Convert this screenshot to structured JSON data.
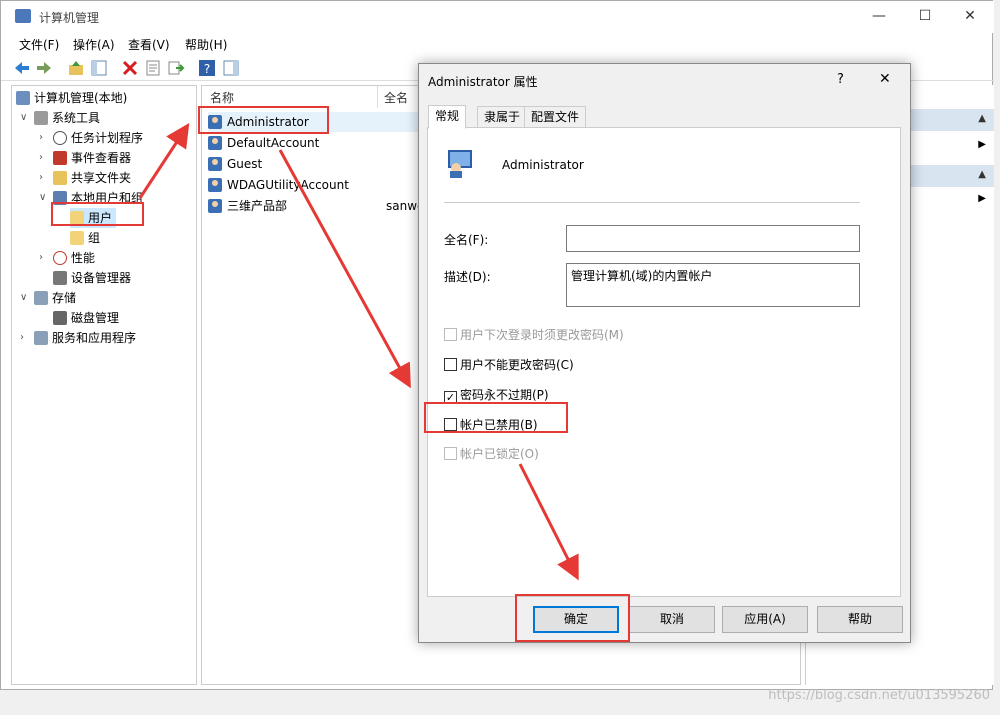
{
  "window": {
    "title": "计算机管理",
    "controls": [
      "—",
      "☐",
      "✕"
    ]
  },
  "menu": [
    "文件(F)",
    "操作(A)",
    "查看(V)",
    "帮助(H)"
  ],
  "tree": [
    {
      "label": "计算机管理(本地)",
      "depth": 0,
      "expander": ""
    },
    {
      "label": "系统工具",
      "depth": 1,
      "expander": "∨"
    },
    {
      "label": "任务计划程序",
      "depth": 2,
      "expander": "›"
    },
    {
      "label": "事件查看器",
      "depth": 2,
      "expander": "›"
    },
    {
      "label": "共享文件夹",
      "depth": 2,
      "expander": "›"
    },
    {
      "label": "本地用户和组",
      "depth": 2,
      "expander": "∨"
    },
    {
      "label": "用户",
      "depth": 3,
      "expander": ""
    },
    {
      "label": "组",
      "depth": 3,
      "expander": ""
    },
    {
      "label": "性能",
      "depth": 2,
      "expander": "›"
    },
    {
      "label": "设备管理器",
      "depth": 2,
      "expander": ""
    },
    {
      "label": "存储",
      "depth": 1,
      "expander": "∨"
    },
    {
      "label": "磁盘管理",
      "depth": 2,
      "expander": ""
    },
    {
      "label": "服务和应用程序",
      "depth": 1,
      "expander": "›"
    }
  ],
  "list": {
    "columns": [
      "名称",
      "全名"
    ],
    "rows": [
      {
        "name": "Administrator",
        "fullname": ""
      },
      {
        "name": "DefaultAccount",
        "fullname": ""
      },
      {
        "name": "Guest",
        "fullname": ""
      },
      {
        "name": "WDAGUtilityAccount",
        "fullname": ""
      },
      {
        "name": "三维产品部",
        "fullname": "sanwe"
      }
    ]
  },
  "dialog": {
    "title": "Administrator 属性",
    "help": "?",
    "close": "✕",
    "tabs": [
      "常规",
      "隶属于",
      "配置文件"
    ],
    "username": "Administrator",
    "fullname_label": "全名(F):",
    "fullname_value": "",
    "desc_label": "描述(D):",
    "desc_value": "管理计算机(域)的内置帐户",
    "checkboxes": [
      {
        "label": "用户下次登录时须更改密码(M)",
        "checked": false,
        "disabled": true
      },
      {
        "label": "用户不能更改密码(C)",
        "checked": false,
        "disabled": false
      },
      {
        "label": "密码永不过期(P)",
        "checked": true,
        "disabled": false
      },
      {
        "label": "帐户已禁用(B)",
        "checked": false,
        "disabled": false
      },
      {
        "label": "帐户已锁定(O)",
        "checked": false,
        "disabled": true
      }
    ],
    "buttons": [
      "确定",
      "取消",
      "应用(A)",
      "帮助"
    ]
  },
  "watermark": "https://blog.csdn.net/u013595260",
  "colors": {
    "highlight": "#e53935",
    "accent": "#0078d7",
    "selection": "#cce8ff"
  }
}
